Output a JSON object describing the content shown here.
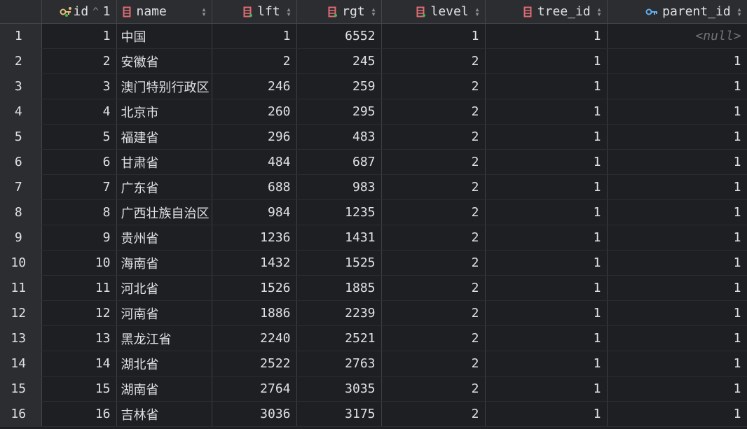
{
  "columns": [
    {
      "key": "id",
      "label": "id",
      "sort_direction": "^",
      "sort_index": "1",
      "icon": "primary-key-icon"
    },
    {
      "key": "name",
      "label": "name",
      "icon": "column-icon"
    },
    {
      "key": "lft",
      "label": "lft",
      "icon": "column-icon"
    },
    {
      "key": "rgt",
      "label": "rgt",
      "icon": "column-icon"
    },
    {
      "key": "level",
      "label": "level",
      "icon": "column-icon"
    },
    {
      "key": "tree_id",
      "label": "tree_id",
      "icon": "column-icon"
    },
    {
      "key": "parent_id",
      "label": "parent_id",
      "icon": "foreign-key-icon"
    }
  ],
  "rows": [
    {
      "row": "1",
      "id": "1",
      "name": "中国",
      "lft": "1",
      "rgt": "6552",
      "level": "1",
      "tree_id": "1",
      "parent_id": "<null>"
    },
    {
      "row": "2",
      "id": "2",
      "name": "安徽省",
      "lft": "2",
      "rgt": "245",
      "level": "2",
      "tree_id": "1",
      "parent_id": "1"
    },
    {
      "row": "3",
      "id": "3",
      "name": "澳门特别行政区",
      "lft": "246",
      "rgt": "259",
      "level": "2",
      "tree_id": "1",
      "parent_id": "1"
    },
    {
      "row": "4",
      "id": "4",
      "name": "北京市",
      "lft": "260",
      "rgt": "295",
      "level": "2",
      "tree_id": "1",
      "parent_id": "1"
    },
    {
      "row": "5",
      "id": "5",
      "name": "福建省",
      "lft": "296",
      "rgt": "483",
      "level": "2",
      "tree_id": "1",
      "parent_id": "1"
    },
    {
      "row": "6",
      "id": "6",
      "name": "甘肃省",
      "lft": "484",
      "rgt": "687",
      "level": "2",
      "tree_id": "1",
      "parent_id": "1"
    },
    {
      "row": "7",
      "id": "7",
      "name": "广东省",
      "lft": "688",
      "rgt": "983",
      "level": "2",
      "tree_id": "1",
      "parent_id": "1"
    },
    {
      "row": "8",
      "id": "8",
      "name": "广西壮族自治区",
      "lft": "984",
      "rgt": "1235",
      "level": "2",
      "tree_id": "1",
      "parent_id": "1"
    },
    {
      "row": "9",
      "id": "9",
      "name": "贵州省",
      "lft": "1236",
      "rgt": "1431",
      "level": "2",
      "tree_id": "1",
      "parent_id": "1"
    },
    {
      "row": "10",
      "id": "10",
      "name": "海南省",
      "lft": "1432",
      "rgt": "1525",
      "level": "2",
      "tree_id": "1",
      "parent_id": "1"
    },
    {
      "row": "11",
      "id": "11",
      "name": "河北省",
      "lft": "1526",
      "rgt": "1885",
      "level": "2",
      "tree_id": "1",
      "parent_id": "1"
    },
    {
      "row": "12",
      "id": "12",
      "name": "河南省",
      "lft": "1886",
      "rgt": "2239",
      "level": "2",
      "tree_id": "1",
      "parent_id": "1"
    },
    {
      "row": "13",
      "id": "13",
      "name": "黑龙江省",
      "lft": "2240",
      "rgt": "2521",
      "level": "2",
      "tree_id": "1",
      "parent_id": "1"
    },
    {
      "row": "14",
      "id": "14",
      "name": "湖北省",
      "lft": "2522",
      "rgt": "2763",
      "level": "2",
      "tree_id": "1",
      "parent_id": "1"
    },
    {
      "row": "15",
      "id": "15",
      "name": "湖南省",
      "lft": "2764",
      "rgt": "3035",
      "level": "2",
      "tree_id": "1",
      "parent_id": "1"
    },
    {
      "row": "16",
      "id": "16",
      "name": "吉林省",
      "lft": "3036",
      "rgt": "3175",
      "level": "2",
      "tree_id": "1",
      "parent_id": "1"
    }
  ],
  "colors": {
    "background": "#1e1f22",
    "header_bg": "#2b2d30",
    "text": "#dfe1e5",
    "null_text": "#6f737a",
    "column_icon": "#e06c75",
    "primary_key_icon": "#e5c07b",
    "foreign_key_icon": "#61afef"
  }
}
